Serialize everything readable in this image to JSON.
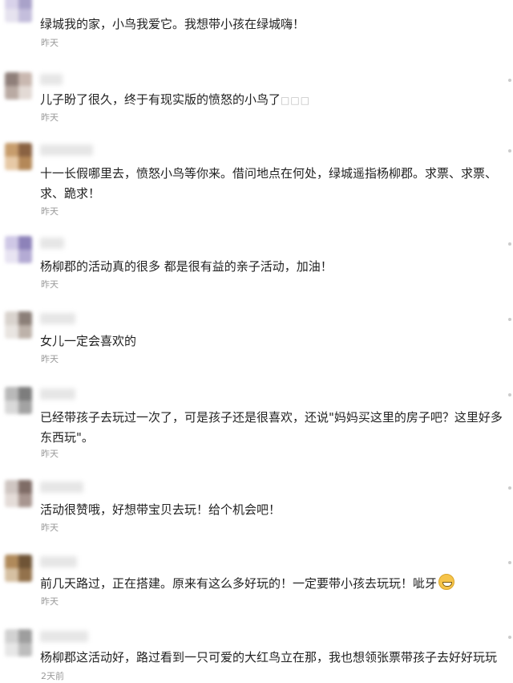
{
  "comments": [
    {
      "text": "绿城我的家，小鸟我爱它。我想带小孩在绿城嗨！",
      "time": "昨天",
      "avatar_colors": [
        "#d8d2ea",
        "#a9a2c9",
        "#e6e3ef",
        "#c4bedc"
      ]
    },
    {
      "text": "儿子盼了很久，终于有现实版的愤怒的小鸟了",
      "suffix": "□□□",
      "time": "昨天",
      "avatar_colors": [
        "#8f7f7a",
        "#c9b8b0",
        "#b9aaa3",
        "#e3dad5"
      ]
    },
    {
      "text": "十一长假哪里去，愤怒小鸟等你来。借问地点在何处，绿城遥指杨柳郡。求票、求票、求、跪求！",
      "time": "昨天",
      "avatar_colors": [
        "#c79d6d",
        "#8a6242",
        "#e7c9a6",
        "#b48858"
      ]
    },
    {
      "text": "杨柳郡的活动真的很多 都是很有益的亲子活动，加油！",
      "time": "昨天",
      "avatar_colors": [
        "#cfc8e6",
        "#8d82b9",
        "#e8e4f2",
        "#b4abd4"
      ]
    },
    {
      "text": "女儿一定会喜欢的",
      "time": "昨天",
      "avatar_colors": [
        "#d9d3ce",
        "#8b7f78",
        "#e9e5e1",
        "#bdb2aa"
      ]
    },
    {
      "text": "已经带孩子去玩过一次了，可是孩子还是很喜欢，还说\"妈妈买这里的房子吧？这里好多东西玩\"。",
      "time": "昨天",
      "avatar_colors": [
        "#b9b9b9",
        "#7d7d7d",
        "#d9d9d9",
        "#a3a3a3"
      ]
    },
    {
      "text": "活动很赞哦，好想带宝贝去玩！给个机会吧！",
      "time": "昨天",
      "avatar_colors": [
        "#cfc6c2",
        "#7f6c66",
        "#e4dcd8",
        "#a89690"
      ]
    },
    {
      "text": "前几天路过，正在搭建。原来有这么多好玩的！一定要带小孩去玩玩！呲牙",
      "time": "昨天",
      "emoji": "grin-emoji",
      "avatar_colors": [
        "#b08a5b",
        "#6f5436",
        "#d6c0a2",
        "#93724c"
      ]
    },
    {
      "text": "杨柳郡这活动好，路过看到一只可爱的大红鸟立在那，我也想领张票带孩子去好好玩玩",
      "time": "2天前",
      "avatar_colors": [
        "#d2d2d2",
        "#9e9e9e",
        "#e7e7e7",
        "#bdbdbd"
      ]
    }
  ]
}
